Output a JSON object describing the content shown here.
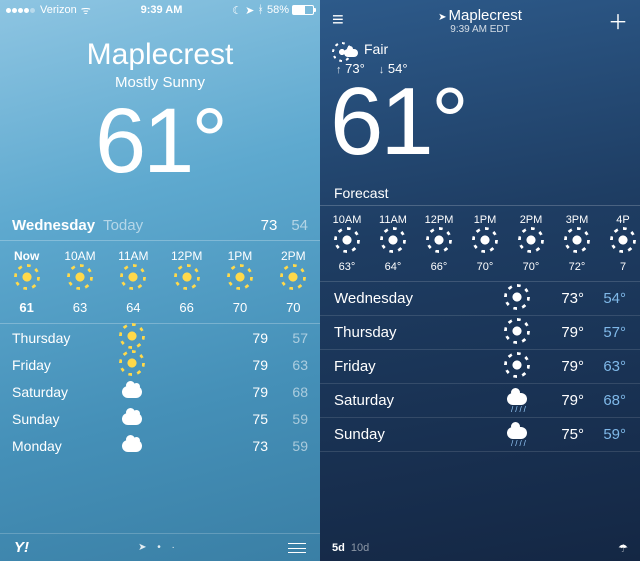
{
  "left": {
    "statusbar": {
      "carrier": "Verizon",
      "time": "9:39 AM",
      "battery": "58%"
    },
    "location": "Maplecrest",
    "condition": "Mostly Sunny",
    "temp": "61°",
    "today": {
      "day": "Wednesday",
      "label": "Today",
      "hi": "73",
      "lo": "54"
    },
    "hourly": [
      {
        "label": "Now",
        "temp": "61",
        "bold": true
      },
      {
        "label": "10AM",
        "temp": "63"
      },
      {
        "label": "11AM",
        "temp": "64"
      },
      {
        "label": "12PM",
        "temp": "66"
      },
      {
        "label": "1PM",
        "temp": "70"
      },
      {
        "label": "2PM",
        "temp": "70"
      }
    ],
    "daily": [
      {
        "day": "Thursday",
        "icon": "sun",
        "hi": "79",
        "lo": "57"
      },
      {
        "day": "Friday",
        "icon": "sun",
        "hi": "79",
        "lo": "63"
      },
      {
        "day": "Saturday",
        "icon": "cloud",
        "hi": "79",
        "lo": "68"
      },
      {
        "day": "Sunday",
        "icon": "cloud",
        "hi": "75",
        "lo": "59"
      },
      {
        "day": "Monday",
        "icon": "cloud",
        "hi": "73",
        "lo": "59"
      }
    ],
    "footer_brand": "Y!"
  },
  "right": {
    "location": "Maplecrest",
    "subtime": "9:39 AM EDT",
    "condition": "Fair",
    "hi": "73°",
    "lo": "54°",
    "temp": "61°",
    "section": "Forecast",
    "hourly": [
      {
        "label": "10AM",
        "temp": "63°"
      },
      {
        "label": "11AM",
        "temp": "64°"
      },
      {
        "label": "12PM",
        "temp": "66°"
      },
      {
        "label": "1PM",
        "temp": "70°"
      },
      {
        "label": "2PM",
        "temp": "70°"
      },
      {
        "label": "3PM",
        "temp": "72°"
      },
      {
        "label": "4P",
        "temp": "7"
      }
    ],
    "daily": [
      {
        "day": "Wednesday",
        "icon": "sun",
        "hi": "73°",
        "lo": "54°"
      },
      {
        "day": "Thursday",
        "icon": "sun",
        "hi": "79°",
        "lo": "57°"
      },
      {
        "day": "Friday",
        "icon": "sun",
        "hi": "79°",
        "lo": "63°"
      },
      {
        "day": "Saturday",
        "icon": "rain",
        "hi": "79°",
        "lo": "68°"
      },
      {
        "day": "Sunday",
        "icon": "rain",
        "hi": "75°",
        "lo": "59°"
      }
    ],
    "footer": {
      "sel": "5d",
      "unsel": "10d"
    }
  }
}
